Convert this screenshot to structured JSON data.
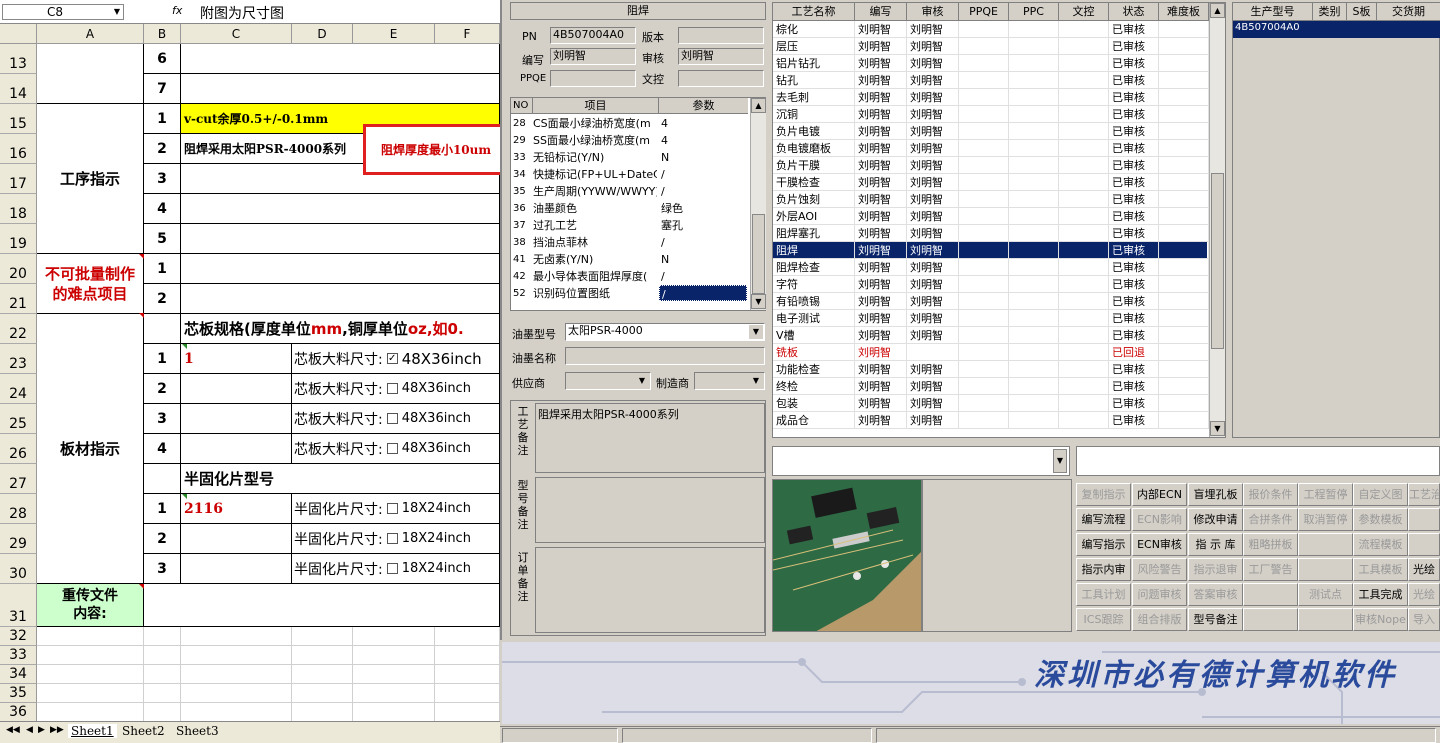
{
  "excel": {
    "name_box": "C8",
    "fx": "fx",
    "formula": "附图为尺寸图",
    "columns": [
      "A",
      "B",
      "C",
      "D",
      "E",
      "F"
    ],
    "row_numbers": [
      "13",
      "14",
      "15",
      "16",
      "17",
      "18",
      "19",
      "20",
      "21",
      "22",
      "23",
      "24",
      "25",
      "26",
      "27",
      "28",
      "29",
      "30",
      "31",
      "32",
      "33",
      "34",
      "35",
      "36"
    ],
    "b_values": [
      "6",
      "7",
      "1",
      "2",
      "3",
      "4",
      "5",
      "1",
      "2",
      "",
      "1",
      "2",
      "3",
      "4",
      "",
      "1",
      "2",
      "3"
    ],
    "a_process": "工序指示",
    "a_difficult": "不可批量制作的难点项目",
    "a_material": "板材指示",
    "a_file": "重传文件内容:",
    "c15": "v-cut余厚0.5+/-0.1mm",
    "c16": "阻焊采用太阳PSR-4000系列",
    "callout": "阻焊厚度最小10um",
    "c22_black": "芯板规格(厚度单位",
    "c22_unit1": "mm",
    "c22_mid": ",铜厚单位",
    "c22_unit2": "oz,如0.",
    "c23": "1",
    "core_label": "芯板大料尺寸:",
    "core_sizes": [
      "48X36inch",
      "48X36inch",
      "48X36inch",
      "48X36inch"
    ],
    "c27": "半固化片型号",
    "c28": "2116",
    "pp_label": "半固化片尺寸:",
    "pp_sizes": [
      "18X24inch",
      "18X24inch",
      "18X24inch"
    ],
    "sheets": [
      "Sheet1",
      "Sheet2",
      "Sheet3"
    ]
  },
  "middle": {
    "title": "阻焊",
    "pn_label": "PN",
    "pn": "4B507004A0",
    "version_label": "版本",
    "version": "",
    "writer_label": "编写",
    "writer": "刘明智",
    "reviewer_label": "审核",
    "reviewer": "刘明智",
    "ppqe_label": "PPQE",
    "ppqe": "",
    "doc_label": "文控",
    "doc": "",
    "param_headers": [
      "NO",
      "项目",
      "参数"
    ],
    "params": [
      [
        "28",
        "CS面最小绿油桥宽度(m",
        "4"
      ],
      [
        "29",
        "SS面最小绿油桥宽度(m",
        "4"
      ],
      [
        "33",
        "无铅标记(Y/N)",
        "N"
      ],
      [
        "34",
        "快捷标记(FP+UL+DateCo",
        "/"
      ],
      [
        "35",
        "生产周期(YYWW/WWYY)",
        "/"
      ],
      [
        "36",
        "油墨颜色",
        "绿色"
      ],
      [
        "37",
        "过孔工艺",
        "塞孔"
      ],
      [
        "38",
        "挡油点菲林",
        "/"
      ],
      [
        "41",
        "无卤素(Y/N)",
        "N"
      ],
      [
        "42",
        "最小导体表面阻焊厚度(",
        "/"
      ],
      [
        "52",
        "识别码位置图纸",
        "/"
      ]
    ],
    "ink_model_label": "油墨型号",
    "ink_model": "太阳PSR-4000",
    "ink_name_label": "油墨名称",
    "ink_name": "",
    "supplier_label": "供应商",
    "supplier": "",
    "maker_label": "制造商",
    "maker": "",
    "process_note_label": "工艺备注",
    "process_note": "阻焊采用太阳PSR-4000系列",
    "model_note_label": "型号备注",
    "order_note_label": "订单备注"
  },
  "process": {
    "headers": [
      "工艺名称",
      "编写",
      "审核",
      "PPQE",
      "PPC",
      "文控",
      "状态",
      "难度板"
    ],
    "rows": [
      [
        "棕化",
        "刘明智",
        "刘明智",
        "已审核"
      ],
      [
        "层压",
        "刘明智",
        "刘明智",
        "已审核"
      ],
      [
        "铝片钻孔",
        "刘明智",
        "刘明智",
        "已审核"
      ],
      [
        "钻孔",
        "刘明智",
        "刘明智",
        "已审核"
      ],
      [
        "去毛刺",
        "刘明智",
        "刘明智",
        "已审核"
      ],
      [
        "沉铜",
        "刘明智",
        "刘明智",
        "已审核"
      ],
      [
        "负片电镀",
        "刘明智",
        "刘明智",
        "已审核"
      ],
      [
        "负电镀磨板",
        "刘明智",
        "刘明智",
        "已审核"
      ],
      [
        "负片干膜",
        "刘明智",
        "刘明智",
        "已审核"
      ],
      [
        "干膜检查",
        "刘明智",
        "刘明智",
        "已审核"
      ],
      [
        "负片蚀刻",
        "刘明智",
        "刘明智",
        "已审核"
      ],
      [
        "外层AOI",
        "刘明智",
        "刘明智",
        "已审核"
      ],
      [
        "阻焊塞孔",
        "刘明智",
        "刘明智",
        "已审核"
      ],
      [
        "阻焊",
        "刘明智",
        "刘明智",
        "已审核"
      ],
      [
        "阻焊检查",
        "刘明智",
        "刘明智",
        "已审核"
      ],
      [
        "字符",
        "刘明智",
        "刘明智",
        "已审核"
      ],
      [
        "有铅喷锡",
        "刘明智",
        "刘明智",
        "已审核"
      ],
      [
        "电子测试",
        "刘明智",
        "刘明智",
        "已审核"
      ],
      [
        "V槽",
        "刘明智",
        "刘明智",
        "已审核"
      ],
      [
        "铣板",
        "刘明智",
        "",
        "已回退"
      ],
      [
        "功能检查",
        "刘明智",
        "刘明智",
        "已审核"
      ],
      [
        "终检",
        "刘明智",
        "刘明智",
        "已审核"
      ],
      [
        "包装",
        "刘明智",
        "刘明智",
        "已审核"
      ],
      [
        "成品仓",
        "刘明智",
        "刘明智",
        "已审核"
      ]
    ],
    "selected_index": 13,
    "returned_index": 19
  },
  "order": {
    "headers": [
      "生产型号",
      "类别",
      "S板",
      "交货期"
    ],
    "rows": [
      [
        "4B507004A0",
        "",
        "",
        ""
      ]
    ]
  },
  "buttons": [
    [
      [
        "复制指示",
        false
      ],
      [
        "内部ECN",
        true
      ],
      [
        "盲埋孔板",
        true
      ],
      [
        "报价条件",
        false
      ],
      [
        "工程暂停",
        false
      ],
      [
        "自定义图",
        false
      ],
      [
        "工艺治",
        false
      ]
    ],
    [
      [
        "编写流程",
        true
      ],
      [
        "ECN影响",
        false
      ],
      [
        "修改申请",
        true
      ],
      [
        "合拼条件",
        false
      ],
      [
        "取消暂停",
        false
      ],
      [
        "参数模板",
        false
      ],
      [
        "",
        false
      ]
    ],
    [
      [
        "编写指示",
        true
      ],
      [
        "ECN审核",
        true
      ],
      [
        "指 示 库",
        true
      ],
      [
        "粗略拼板",
        false
      ],
      [
        "",
        false
      ],
      [
        "流程模板",
        false
      ],
      [
        "",
        false
      ]
    ],
    [
      [
        "指示内审",
        true
      ],
      [
        "风险警告",
        false
      ],
      [
        "指示退审",
        false
      ],
      [
        "工厂警告",
        false
      ],
      [
        "",
        false
      ],
      [
        "工具模板",
        false
      ],
      [
        "光绘",
        true
      ]
    ],
    [
      [
        "工具计划",
        false
      ],
      [
        "问题审核",
        false
      ],
      [
        "答案审核",
        false
      ],
      [
        "",
        false
      ],
      [
        "测试点",
        false
      ],
      [
        "工具完成",
        true
      ],
      [
        "光绘",
        false
      ]
    ],
    [
      [
        "ICS跟踪",
        false
      ],
      [
        "组合排版",
        false
      ],
      [
        "型号备注",
        true
      ],
      [
        "",
        false
      ],
      [
        "",
        false
      ],
      [
        "审核Nope",
        false
      ],
      [
        "导入",
        false
      ]
    ]
  ],
  "banner": "深圳市必有德计算机软件",
  "colors": {
    "selected": "#0a246a",
    "yellow": "#ffff00",
    "red": "#cc0000",
    "green_cell": "#ccffcc",
    "banner": "#2a4a9c"
  }
}
